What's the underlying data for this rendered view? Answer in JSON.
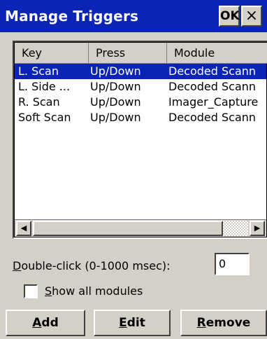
{
  "window": {
    "title": "Manage Triggers",
    "ok_label": "OK",
    "close_label": "×"
  },
  "list": {
    "columns": [
      "Key",
      "Press",
      "Module"
    ],
    "rows": [
      {
        "key": "L. Scan",
        "press": "Up/Down",
        "module": "Decoded Scann",
        "selected": true
      },
      {
        "key": "L. Side ...",
        "press": "Up/Down",
        "module": "Decoded Scann",
        "selected": false
      },
      {
        "key": "R. Scan",
        "press": "Up/Down",
        "module": "Imager_Capture",
        "selected": false
      },
      {
        "key": "Soft Scan",
        "press": "Up/Down",
        "module": "Decoded Scann",
        "selected": false
      }
    ],
    "scroll_left_icon": "◀",
    "scroll_right_icon": "▶"
  },
  "double_click": {
    "label_first": "D",
    "label_rest": "ouble-click (0-1000 msec):",
    "value": "0"
  },
  "show_all": {
    "label_first": "S",
    "label_rest": "how all modules",
    "checked": false
  },
  "buttons": {
    "add_first": "A",
    "add_rest": "dd",
    "edit_first": "E",
    "edit_rest": "dit",
    "remove_first": "R",
    "remove_rest": "emove"
  },
  "colors": {
    "titlebar": "#0a24b6",
    "selection": "#0a24b6",
    "face": "#d4d0c8"
  }
}
